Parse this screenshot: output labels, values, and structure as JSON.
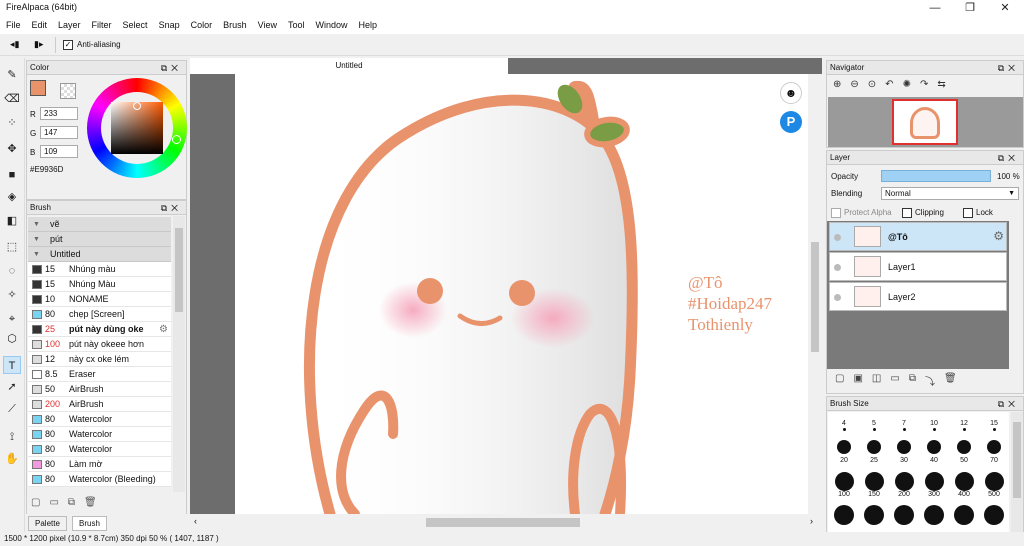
{
  "window": {
    "title": "FireAlpaca (64bit)",
    "min_glyph": "—",
    "max_glyph": "❐",
    "close_glyph": "✕"
  },
  "menu": [
    "File",
    "Edit",
    "Layer",
    "Filter",
    "Select",
    "Snap",
    "Color",
    "Brush",
    "View",
    "Tool",
    "Window",
    "Help"
  ],
  "toolbar": {
    "antialias_label": "Anti-aliasing",
    "antialias_checked": true
  },
  "color_panel": {
    "title": "Color",
    "r": "233",
    "g": "147",
    "b": "109",
    "hex": "#E9936D",
    "fg_color": "#E9936D"
  },
  "brush_panel": {
    "title": "Brush",
    "groups": [
      {
        "label": "vẽ"
      },
      {
        "label": "pút"
      },
      {
        "label": "Untitled"
      }
    ],
    "brushes": [
      {
        "size": "15",
        "name": "Nhúng màu",
        "swatch": "#333333",
        "red": false,
        "selected": false
      },
      {
        "size": "15",
        "name": "Nhúng Màu",
        "swatch": "#333333",
        "red": false,
        "selected": false
      },
      {
        "size": "10",
        "name": "NONAME",
        "swatch": "#333333",
        "red": false,
        "selected": false
      },
      {
        "size": "80",
        "name": "chẹp [Screen]",
        "swatch": "#7ad3f0",
        "red": false,
        "selected": false
      },
      {
        "size": "25",
        "name": "pút này dùng oke",
        "swatch": "#333333",
        "red": true,
        "selected": true
      },
      {
        "size": "100",
        "name": "pút này okeee hơn",
        "swatch": "#dddddd",
        "red": true,
        "selected": false
      },
      {
        "size": "12",
        "name": "này cx oke lém",
        "swatch": "#dddddd",
        "red": false,
        "selected": false
      },
      {
        "size": "8.5",
        "name": "Eraser",
        "swatch": "#ffffff",
        "red": false,
        "selected": false
      },
      {
        "size": "50",
        "name": "AirBrush",
        "swatch": "#dddddd",
        "red": false,
        "selected": false
      },
      {
        "size": "200",
        "name": "AirBrush",
        "swatch": "#dddddd",
        "red": true,
        "selected": false
      },
      {
        "size": "80",
        "name": "Watercolor",
        "swatch": "#7ad3f0",
        "red": false,
        "selected": false
      },
      {
        "size": "80",
        "name": "Watercolor",
        "swatch": "#7ad3f0",
        "red": false,
        "selected": false
      },
      {
        "size": "80",
        "name": "Watercolor",
        "swatch": "#7ad3f0",
        "red": false,
        "selected": false
      },
      {
        "size": "80",
        "name": "Làm mờ",
        "swatch": "#f29ae0",
        "red": false,
        "selected": false
      },
      {
        "size": "80",
        "name": "Watercolor (Bleeding)",
        "swatch": "#7ad3f0",
        "red": false,
        "selected": false
      }
    ]
  },
  "canvas": {
    "tab_title": "Untitled",
    "watermark_lines": [
      "@Tô",
      "#Hoidap247",
      "Tothienly"
    ],
    "watermark_color": "#E9936D"
  },
  "navigator": {
    "title": "Navigator"
  },
  "layer_panel": {
    "title": "Layer",
    "opacity_label": "Opacity",
    "opacity_value": "100 %",
    "opacity_percent": 100,
    "blending_label": "Blending",
    "blending_value": "Normal",
    "protect_alpha": "Protect Alpha",
    "clipping": "Clipping",
    "lock": "Lock",
    "layers": [
      {
        "name": "@Tô",
        "selected": true
      },
      {
        "name": "Layer1",
        "selected": false
      },
      {
        "name": "Layer2",
        "selected": false
      }
    ]
  },
  "brush_size": {
    "title": "Brush Size",
    "labels": [
      "4",
      "5",
      "7",
      "10",
      "12",
      "15",
      "20",
      "25",
      "30",
      "40",
      "50",
      "70",
      "100",
      "150",
      "200",
      "300",
      "400",
      "500"
    ]
  },
  "bottom_tabs": {
    "palette": "Palette",
    "brush": "Brush"
  },
  "status": {
    "text": "1500 * 1200 pixel   (10.9 * 8.7cm)   350 dpi   50 %   ( 1407, 1187 )"
  }
}
